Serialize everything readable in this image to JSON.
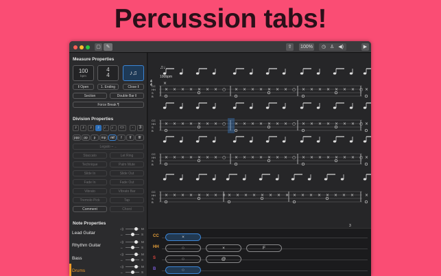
{
  "headline": "Percussion tabs!",
  "toolbar": {
    "zoom": "100%",
    "icons": [
      "share-icon",
      "timer-icon",
      "metronome-icon",
      "speaker-icon",
      "play-icon"
    ]
  },
  "measure": {
    "title": "Measure Properties",
    "tempo_value": "100",
    "tempo_unit": "bpm",
    "time_top": "4",
    "time_bottom": "4",
    "open": "‖ Open",
    "ending": "1. Ending",
    "close": "Close ‖",
    "section": "Section",
    "double_bar": "Double Bar ‖",
    "force_break": "Force Break ¶"
  },
  "division": {
    "title": "Division Properties",
    "durations": [
      "𝅘𝅥",
      "𝅘𝅥𝅮",
      "𝅘𝅥𝅯",
      "𝅘𝅥𝅰",
      "𝅗𝅥",
      "𝅝",
      "○",
      "–",
      "3"
    ],
    "dynamics": [
      "ppp",
      "pp",
      "p",
      "mp",
      "mf",
      "f",
      "ff",
      "fff"
    ],
    "legato": "Legato ⌣→",
    "staccato": "Staccato",
    "let_ring": "Let Ring",
    "technique": "Technique",
    "palm_mute": "Palm Mute",
    "slide_in": "Slide In",
    "slide_out": "Slide Out",
    "fade_in": "Fade In",
    "fade_out": "Fade Out",
    "vibrato": "Vibrato",
    "vibrato_bar": "Vibrato Bar",
    "tremolo_pick": "Tremolo Pick",
    "tap": "Tap",
    "comment": "Comment",
    "chord": "Chord"
  },
  "note_props": {
    "title": "Note Properties",
    "tracks": [
      {
        "name": "Lead Guitar",
        "active": false
      },
      {
        "name": "Rhythm Guitar",
        "active": false
      },
      {
        "name": "Bass",
        "active": false
      },
      {
        "name": "Drums",
        "active": true
      }
    ]
  },
  "sheet": {
    "tempo": "100bpm",
    "time_top": "4",
    "time_bottom": "4",
    "lines": [
      "CC",
      "HH",
      "S",
      "B"
    ],
    "triplet": "3"
  },
  "pad": {
    "rows": [
      {
        "label": "CC",
        "color": "#e8a13a",
        "notes": [
          "×"
        ]
      },
      {
        "label": "HH",
        "color": "#e8a13a",
        "notes": [
          "○",
          "×",
          "F"
        ]
      },
      {
        "label": "S",
        "color": "#e0473f",
        "notes": [
          "○",
          "@"
        ]
      },
      {
        "label": "B",
        "color": "#7b5cd6",
        "notes": [
          "○"
        ]
      }
    ]
  },
  "colors": {
    "background": "#fa4d74",
    "accent": "#3b86d8",
    "drums": "#f09a2a"
  }
}
